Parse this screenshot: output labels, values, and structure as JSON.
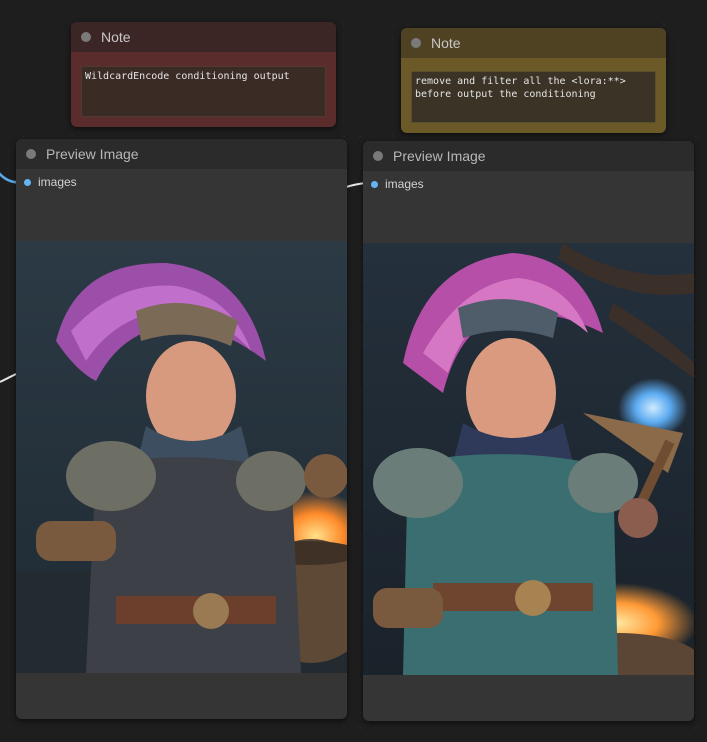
{
  "notes": [
    {
      "title": "Note",
      "text": "WildcardEncode conditioning output"
    },
    {
      "title": "Note",
      "text": "remove and filter all the <lora:**>\nbefore output the conditioning"
    }
  ],
  "previews": [
    {
      "title": "Preview Image",
      "slot_label": "images"
    },
    {
      "title": "Preview Image",
      "slot_label": "images"
    }
  ],
  "colors": {
    "canvas": "#1e1e1e",
    "note_red": "#5a2c2c",
    "note_yellow": "#6b5a28",
    "node_body": "#353535",
    "slot_blue": "#64b5f6"
  },
  "icons": [
    "status-dot-icon",
    "input-slot-icon"
  ]
}
